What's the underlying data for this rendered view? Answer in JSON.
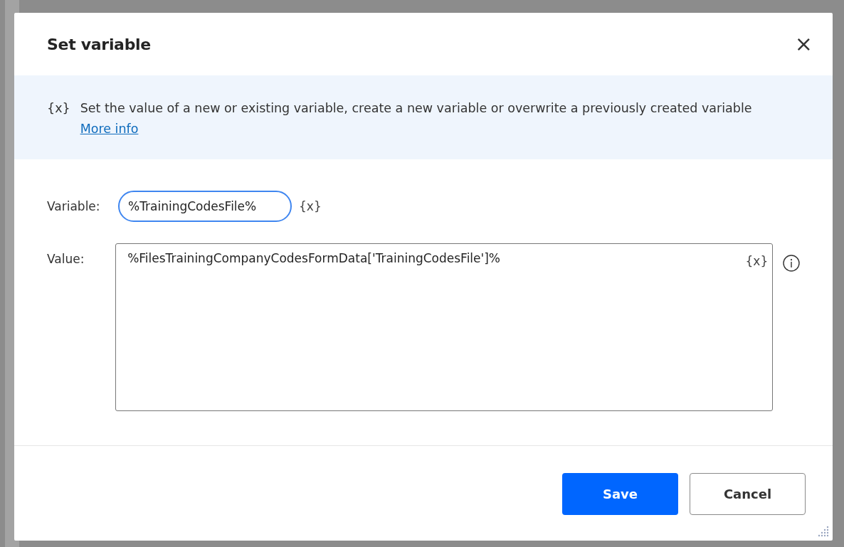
{
  "dialog": {
    "title": "Set variable",
    "close_label": "×"
  },
  "info": {
    "icon": "{x}",
    "text": "Set the value of a new or existing variable, create a new variable or overwrite a previously created variable",
    "link": "More info"
  },
  "fields": [
    {
      "kind": "pill",
      "label": "Variable:",
      "value": "%TrainingCodesFile%",
      "var_button": "{x}"
    },
    {
      "kind": "area",
      "label": "Value:",
      "value": "%FilesTrainingCompanyCodesFormData['TrainingCodesFile']%",
      "var_button": "{x}"
    }
  ],
  "buttons": [
    {
      "label": "Save",
      "kind": "primary"
    },
    {
      "label": "Cancel",
      "kind": "secondary"
    }
  ]
}
